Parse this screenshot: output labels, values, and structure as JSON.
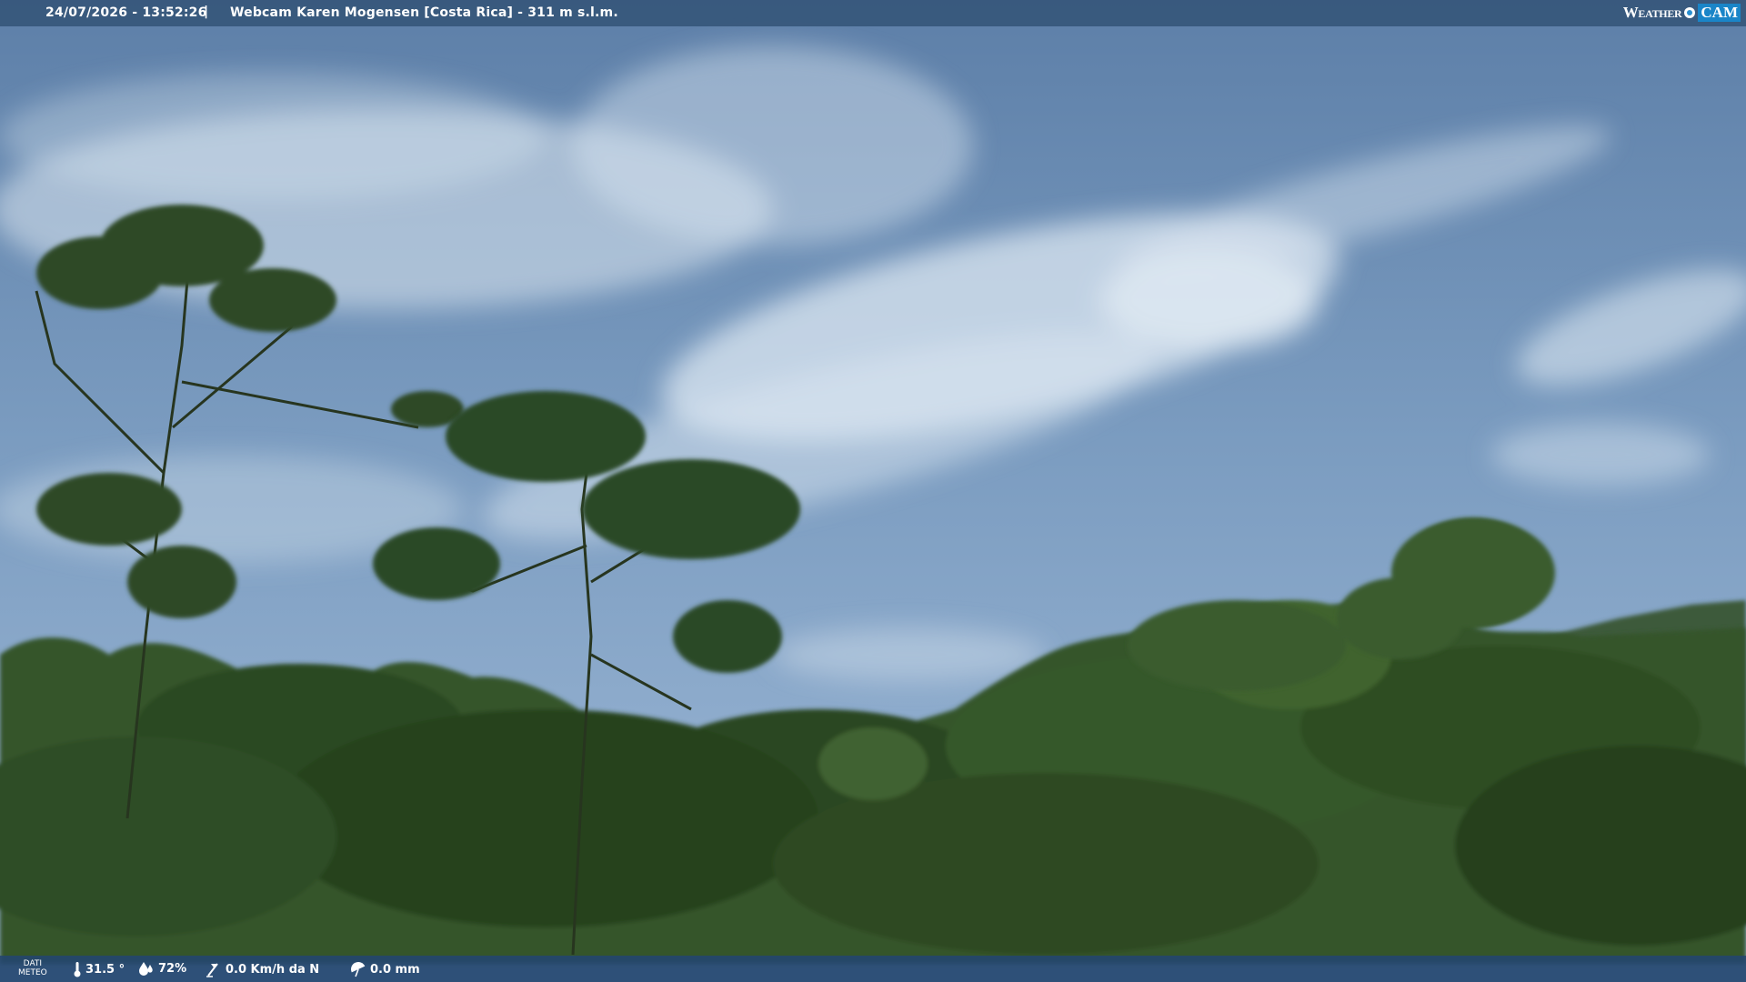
{
  "header": {
    "timestamp": "24/07/2026 - 13:52:26",
    "separator": "|",
    "title": "Webcam Karen Mogensen [Costa Rica]  - 311 m s.l.m.",
    "logo_text_weather": "Weather",
    "logo_text_cam": "CAM"
  },
  "footer": {
    "label_line1": "DATI",
    "label_line2": "METEO",
    "temperature": "31.5 °",
    "humidity": "72%",
    "wind": "0.0 Km/h da N",
    "rain": "0.0 mm",
    "icons": {
      "temperature": "thermometer-icon",
      "humidity": "humidity-drop-icon",
      "wind": "wind-vane-icon",
      "rain": "rain-umbrella-icon"
    }
  },
  "colors": {
    "sky": "#6b8db5",
    "cloud": "#e7eef5",
    "foliage": "#2f4e22",
    "topbar": "#345478",
    "logo_accent": "#1a85c8"
  }
}
